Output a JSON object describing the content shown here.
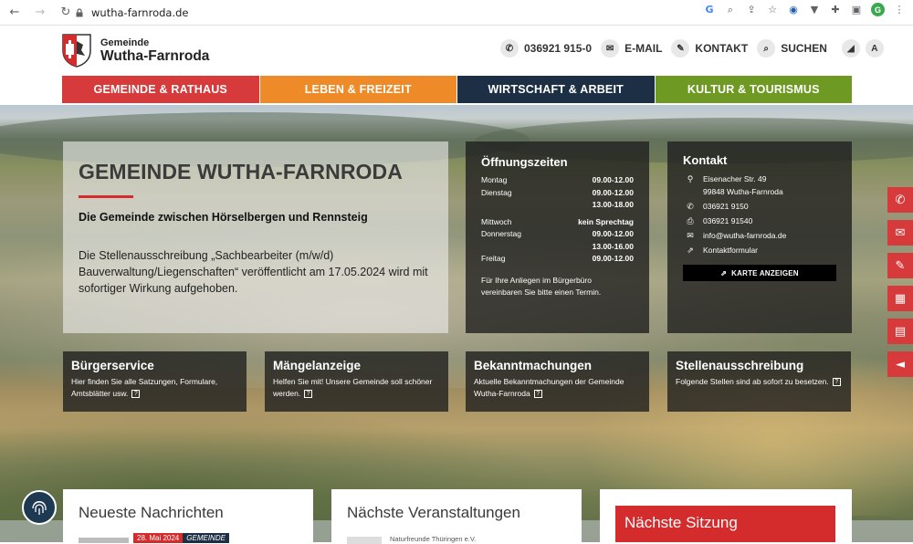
{
  "browser": {
    "url": "wutha-farnroda.de",
    "avatar_letter": "G"
  },
  "logo": {
    "small": "Gemeinde",
    "big": "Wutha-Farnroda"
  },
  "contact_bar": {
    "phone": "036921 915-0",
    "email": "E-MAIL",
    "kontakt": "KONTAKT",
    "suchen": "SUCHEN"
  },
  "colors": {
    "red": "#d73a3a",
    "orange": "#ee8a28",
    "navy": "#1d2f44",
    "green": "#6e9a24"
  },
  "nav": [
    {
      "label": "GEMEINDE & RATHAUS",
      "color": "#d73a3a"
    },
    {
      "label": "LEBEN & FREIZEIT",
      "color": "#ee8a28"
    },
    {
      "label": "WIRTSCHAFT & ARBEIT",
      "color": "#1d2f44"
    },
    {
      "label": "KULTUR & TOURISMUS",
      "color": "#6e9a24"
    }
  ],
  "intro": {
    "title": "GEMEINDE WUTHA-FARNRODA",
    "subtitle": "Die Gemeinde zwischen Hörselbergen und Rennsteig",
    "text": "Die Stellenausschreibung „Sachbearbeiter (m/w/d) Bauverwaltung/Liegenschaften“ veröffentlicht am 17.05.2024 wird mit sofortiger Wirkung aufgehoben."
  },
  "hours": {
    "title": "Öffnungszeiten",
    "rows": [
      {
        "day": "Montag",
        "time": "09.00-12.00"
      },
      {
        "day": "Dienstag",
        "time": "09.00-12.00"
      },
      {
        "day": "",
        "time": "13.00-18.00"
      },
      {
        "day": "",
        "time": ""
      },
      {
        "day": "Mittwoch",
        "time": "kein Sprechtag"
      },
      {
        "day": "Donnerstag",
        "time": "09.00-12.00"
      },
      {
        "day": "",
        "time": "13.00-16.00"
      },
      {
        "day": "Freitag",
        "time": "09.00-12.00"
      }
    ],
    "note": "Für Ihre Anliegen im Bürgerbüro vereinbaren Sie bitte einen Termin."
  },
  "kontakt": {
    "title": "Kontakt",
    "street": "Eisenacher Str. 49",
    "city": "99848 Wutha-Farnroda",
    "phone": "036921 9150",
    "fax": "036921 91540",
    "email": "info@wutha-farnroda.de",
    "form": "Kontaktformular",
    "map_button": "KARTE ANZEIGEN"
  },
  "tiles": [
    {
      "title": "Bürgerservice",
      "text": "Hier finden Sie alle Satzungen, Formulare, Amtsblätter usw."
    },
    {
      "title": "Mängelanzeige",
      "text": "Helfen Sie mit! Unsere Gemeinde soll schöner werden."
    },
    {
      "title": "Bekanntmachungen",
      "text": "Aktuelle Bekanntmachungen der Gemeinde Wutha-Farnroda"
    },
    {
      "title": "Stellenausschreibung",
      "text": "Folgende Stellen sind ab sofort zu besetzen."
    }
  ],
  "cards": {
    "news": {
      "title": "Neueste Nachrichten",
      "date": "28. Mai 2024",
      "tag": "GEMEINDE"
    },
    "events": {
      "title": "Nächste Veranstaltungen",
      "snippet": "Naturfreunde Thüringen e.V."
    },
    "session": {
      "title": "Nächste Sitzung"
    }
  },
  "icons": {
    "side": [
      "phone-icon",
      "envelope-icon",
      "pencil-icon",
      "calendar-icon",
      "newspaper-icon",
      "megaphone-icon"
    ]
  }
}
